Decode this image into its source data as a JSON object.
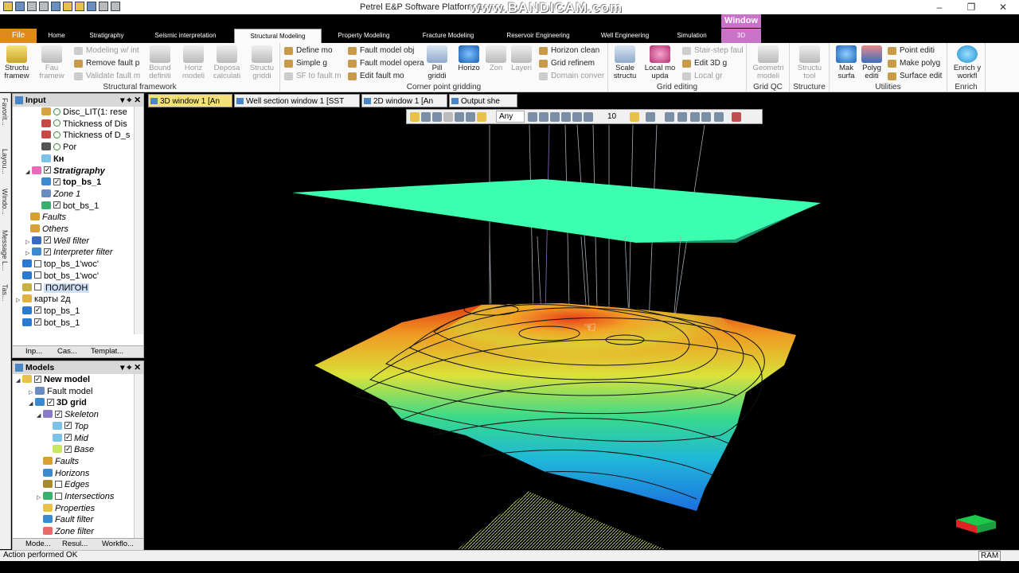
{
  "title_bar": {
    "window_title": "Petrel E&P Software Platform 2",
    "watermark": "www.BANDICAM.com",
    "context_tab": "Window",
    "minimize": "–",
    "restore": "❐",
    "close": "✕"
  },
  "ribbon_tabs": [
    "File",
    "Home",
    "Stratigraphy",
    "Seismic interpretation",
    "Structural Modeling",
    "Property Modeling",
    "Fracture Modeling",
    "Reservoir Engineering",
    "Well Engineering",
    "Simulation",
    "3D"
  ],
  "ribbon": {
    "structural_framework": {
      "label": "Structural framework",
      "big": [
        "Structu framew",
        "Fau framew"
      ],
      "small": [
        "Modeling w/ int",
        "Remove fault p",
        "Validate fault m"
      ],
      "big2": [
        "Bound definiti",
        "Horiz modeli",
        "Deposa calculati",
        "Structu griddi"
      ]
    },
    "corner_point": {
      "label": "Corner point gridding",
      "small1": [
        "Define mo",
        "Simple g",
        "SF to fault m"
      ],
      "small2": [
        "Fault model obj",
        "Fault model opera",
        "Edit fault mo"
      ],
      "big": [
        "Pill griddi",
        "Horizo",
        "Zon",
        "Layeri"
      ],
      "small3": [
        "Horizon clean",
        "Grid refinem",
        "Domain conver"
      ]
    },
    "grid_editing": {
      "label": "Grid editing",
      "big": [
        "Scale structu",
        "Local mo upda"
      ],
      "small": [
        "Stair-step faul",
        "Edit 3D g",
        "Local gr"
      ]
    },
    "grid_qc": {
      "label": "Grid QC",
      "big": [
        "Geometri modeli"
      ]
    },
    "structure": {
      "label": "Structure",
      "big": [
        "Structu tool"
      ]
    },
    "utilities": {
      "label": "Utilities",
      "big": [
        "Mak surfa",
        "Polyg editi"
      ],
      "small": [
        "Point editi",
        "Make polyg",
        "Surface edit"
      ]
    },
    "enrich": {
      "label": "Enrich",
      "big": [
        "Enrich y workfl"
      ]
    }
  },
  "left_strip": [
    "Favorit...",
    "Layou...",
    "Windo...",
    "Message L...",
    "Tas..."
  ],
  "input_panel": {
    "title": "Input",
    "items": [
      {
        "label": "Disc_LIT(1: rese",
        "style": ""
      },
      {
        "label": "Thickness of Dis",
        "style": ""
      },
      {
        "label": "Thickness of D_s",
        "style": ""
      },
      {
        "label": "Por",
        "style": ""
      },
      {
        "label": "Кн",
        "style": "bd"
      },
      {
        "label": "Stratigraphy",
        "style": "it bd"
      },
      {
        "label": "top_bs_1",
        "style": "bd"
      },
      {
        "label": "Zone 1",
        "style": "it"
      },
      {
        "label": "bot_bs_1",
        "style": ""
      },
      {
        "label": "Faults",
        "style": "it"
      },
      {
        "label": "Others",
        "style": "it"
      },
      {
        "label": "Well filter",
        "style": "it"
      },
      {
        "label": "Interpreter filter",
        "style": "it"
      },
      {
        "label": "top_bs_1'woc'",
        "style": ""
      },
      {
        "label": "bot_bs_1'woc'",
        "style": ""
      },
      {
        "label": "ПОЛИГОН",
        "style": "hl"
      },
      {
        "label": "карты 2д",
        "style": ""
      },
      {
        "label": "top_bs_1",
        "style": ""
      },
      {
        "label": "bot_bs_1",
        "style": ""
      }
    ],
    "tabs": [
      "Inp...",
      "Cas...",
      "Templat..."
    ]
  },
  "models_panel": {
    "title": "Models",
    "items": [
      {
        "label": "New model",
        "style": "bd"
      },
      {
        "label": "Fault model",
        "style": ""
      },
      {
        "label": "3D grid",
        "style": "bd"
      },
      {
        "label": "Skeleton",
        "style": "it"
      },
      {
        "label": "Top",
        "style": "it"
      },
      {
        "label": "Mid",
        "style": "it"
      },
      {
        "label": "Base",
        "style": "it"
      },
      {
        "label": "Faults",
        "style": "it"
      },
      {
        "label": "Horizons",
        "style": "it"
      },
      {
        "label": "Edges",
        "style": "it"
      },
      {
        "label": "Intersections",
        "style": "it"
      },
      {
        "label": "Properties",
        "style": "it"
      },
      {
        "label": "Fault filter",
        "style": "it"
      },
      {
        "label": "Zone filter",
        "style": "it"
      }
    ],
    "tabs": [
      "Mode...",
      "Resul...",
      "Workflo..."
    ]
  },
  "doc_tabs": [
    "3D window 1 [An",
    "Well section window 1 [SST",
    "2D window 1 [An",
    "Output she"
  ],
  "viewer_toolbar": {
    "mode": "Any",
    "value": "10"
  },
  "status": {
    "message": "Action performed OK",
    "ram": "RAM"
  },
  "colors": {
    "file_tab": "#e08a1b",
    "context": "#c872c8",
    "active_doc": "#f5e17a",
    "surface_top": "#3dffb0"
  }
}
